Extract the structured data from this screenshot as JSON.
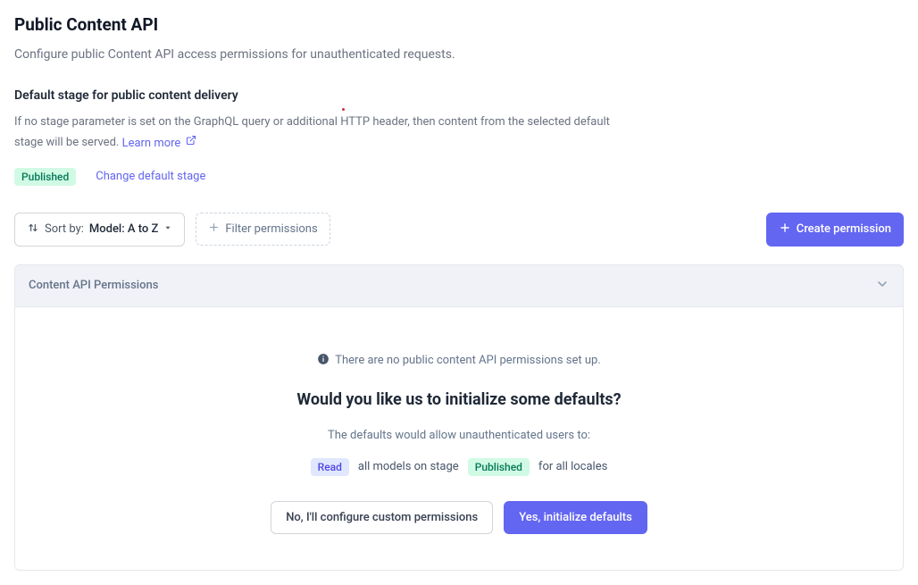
{
  "header": {
    "title": "Public Content API",
    "subtitle": "Configure public Content API access permissions for unauthenticated requests."
  },
  "defaultStage": {
    "sectionTitle": "Default stage for public content delivery",
    "description": "If no stage parameter is set on the GraphQL query or additional HTTP header, then content from the selected default stage will be served. ",
    "learnMore": "Learn more",
    "badge": "Published",
    "changeLabel": "Change default stage"
  },
  "toolbar": {
    "sortPrefix": "Sort by:",
    "sortValue": "Model: A to Z",
    "filterLabel": "Filter permissions",
    "createLabel": "Create permission"
  },
  "panel": {
    "headerTitle": "Content API Permissions",
    "emptyState": "There are no public content API permissions set up.",
    "promptHeading": "Would you like us to initialize some defaults?",
    "defaultsDesc": "The defaults would allow unauthenticated users to:",
    "readBadge": "Read",
    "textMid": "all models on stage",
    "publishedBadge": "Published",
    "textEnd": "for all locales",
    "noLabel": "No, I'll configure custom permissions",
    "yesLabel": "Yes, initialize defaults"
  }
}
